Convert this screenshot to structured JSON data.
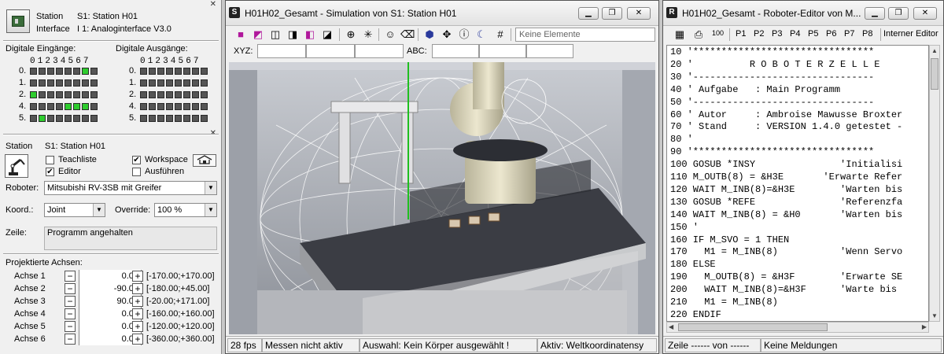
{
  "left_panel": {
    "station_title": "Station",
    "station_value": "S1: Station H01",
    "interface_title": "Interface",
    "interface_value": "I 1: Analoginterface V3.0",
    "inputs_title": "Digitale Eingänge:",
    "outputs_title": "Digitale Ausgänge:",
    "bit_header": "01234567",
    "row_labels": [
      "0.",
      "1.",
      "2.",
      "4.",
      "5."
    ],
    "inputs_on": [
      [
        6
      ],
      [],
      [
        0
      ],
      [
        4,
        5,
        6
      ],
      [
        1
      ]
    ],
    "outputs_on": [
      [],
      [],
      [],
      [],
      []
    ],
    "robot_section": {
      "station_title": "Station",
      "station_value": "S1: Station H01",
      "teachliste_label": "Teachliste",
      "teachliste_checked": false,
      "editor_label": "Editor",
      "editor_checked": true,
      "workspace_label": "Workspace",
      "workspace_checked": true,
      "ausfuehren_label": "Ausführen",
      "ausfuehren_checked": false,
      "roboter_label": "Roboter:",
      "roboter_value": "Mitsubishi RV-3SB mit Greifer",
      "koord_label": "Koord.:",
      "koord_value": "Joint",
      "override_label": "Override:",
      "override_value": "100 %",
      "zeile_label": "Zeile:",
      "zeile_value": "Programm angehalten",
      "axes_title": "Projektierte Achsen:",
      "axes": [
        {
          "name": "Achse 1",
          "value": "0.00",
          "range": "[-170.00;+170.00]"
        },
        {
          "name": "Achse 2",
          "value": "-90.00",
          "range": "[-180.00;+45.00]"
        },
        {
          "name": "Achse 3",
          "value": "90.00",
          "range": "[-20.00;+171.00]"
        },
        {
          "name": "Achse 4",
          "value": "0.00",
          "range": "[-160.00;+160.00]"
        },
        {
          "name": "Achse 5",
          "value": "0.00",
          "range": "[-120.00;+120.00]"
        },
        {
          "name": "Achse 6",
          "value": "0.00",
          "range": "[-360.00;+360.00]"
        }
      ],
      "minus": "−",
      "plus": "+"
    }
  },
  "sim_window": {
    "title": "H01H02_Gesamt - Simulation von S1: Station H01",
    "app_letter": "S",
    "selection_field": "Keine Elemente",
    "xyz_label": "XYZ:",
    "abc_label": "ABC:",
    "status": {
      "fps": "28 fps",
      "measure": "Messen nicht aktiv",
      "selection": "Auswahl: Kein Körper ausgewählt !",
      "active": "Aktiv: Weltkoordinatensy"
    }
  },
  "editor_window": {
    "title": "H01H02_Gesamt - Roboter-Editor von M...",
    "app_letter": "R",
    "zoom_label": "100",
    "program_tabs": [
      "P1",
      "P2",
      "P3",
      "P4",
      "P5",
      "P6",
      "P7",
      "P8"
    ],
    "editor_mode": "Interner Editor",
    "code_lines": [
      "10 '********************************",
      "20 '          R O B O T E R Z E L L E",
      "30 '--------------------------------",
      "40 ' Aufgabe   : Main Programm",
      "50 '--------------------------------",
      "60 ' Autor     : Ambroise Mawusse Broxter",
      "70 ' Stand     : VERSION 1.4.0 getestet -",
      "80 '",
      "90 '********************************",
      "100 GOSUB *INSY               'Initialisi",
      "110 M_OUTB(8) = &H3E       'Erwarte Refer",
      "120 WAIT M_INB(8)=&H3E        'Warten bis",
      "130 GOSUB *REFE               'Referenzfa",
      "140 WAIT M_INB(8) = &H0       'Warten bis",
      "150 '",
      "160 IF M_SVO = 1 THEN",
      "170   M1 = M_INB(8)           'Wenn Servo",
      "180 ELSE",
      "190   M_OUTB(8) = &H3F        'Erwarte SE",
      "200   WAIT M_INB(8)=&H3F      'Warte bis",
      "210   M1 = M_INB(8)",
      "220 ENDIF"
    ],
    "status": {
      "line": "Zeile ------ von ------",
      "messages": "Keine Meldungen"
    }
  },
  "colors": {
    "io_on": "#2ecc2e",
    "io_off": "#555555",
    "viewport_bg": "#b8bcc4"
  }
}
